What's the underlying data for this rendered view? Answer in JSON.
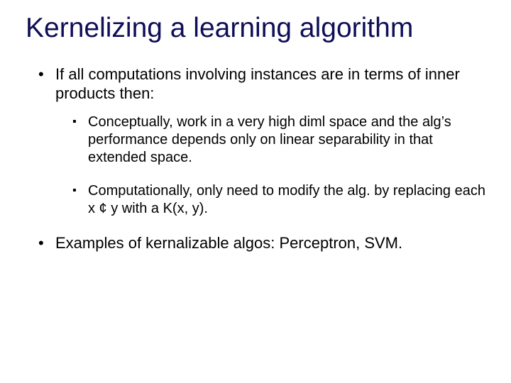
{
  "title": "Kernelizing a learning algorithm",
  "bullets": {
    "intro": "If  all computations involving instances are in terms of inner products then:",
    "sub1": "Conceptually, work in a very high diml space and the alg’s performance depends only on linear separability in that extended space.",
    "sub2": "Computationally, only need to modify the alg. by replacing each x ¢ y with a K(x, y).",
    "examples": "Examples of kernalizable algos: Perceptron, SVM."
  }
}
